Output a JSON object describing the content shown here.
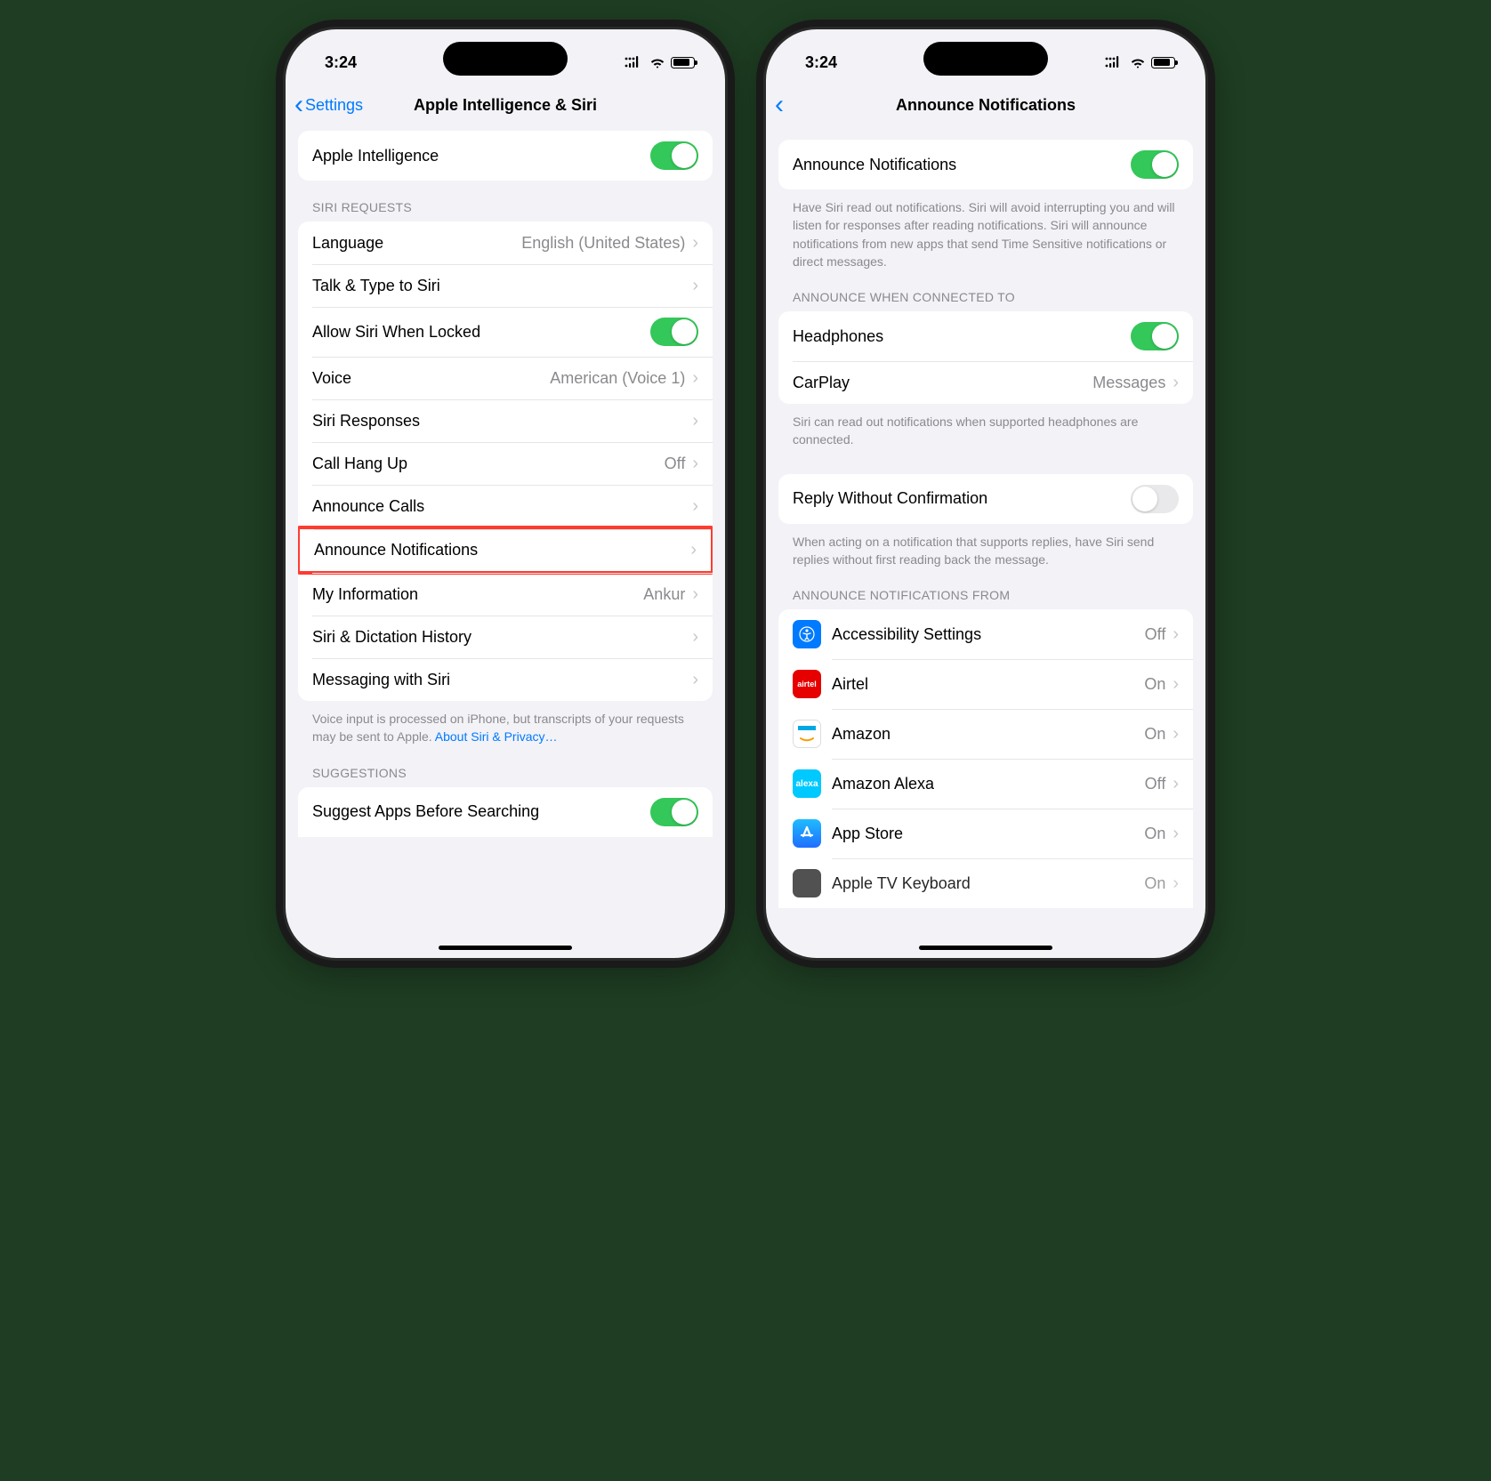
{
  "status": {
    "time": "3:24"
  },
  "left": {
    "back": "Settings",
    "title": "Apple Intelligence & Siri",
    "group1": [
      {
        "label": "Apple Intelligence",
        "type": "toggle",
        "on": true
      }
    ],
    "sec1_header": "SIRI REQUESTS",
    "group2": [
      {
        "label": "Language",
        "value": "English (United States)",
        "type": "nav"
      },
      {
        "label": "Talk & Type to Siri",
        "type": "nav"
      },
      {
        "label": "Allow Siri When Locked",
        "type": "toggle",
        "on": true
      },
      {
        "label": "Voice",
        "value": "American (Voice 1)",
        "type": "nav"
      },
      {
        "label": "Siri Responses",
        "type": "nav"
      },
      {
        "label": "Call Hang Up",
        "value": "Off",
        "type": "nav"
      },
      {
        "label": "Announce Calls",
        "type": "nav"
      },
      {
        "label": "Announce Notifications",
        "type": "nav",
        "highlight": true
      },
      {
        "label": "My Information",
        "value": "Ankur",
        "type": "nav"
      },
      {
        "label": "Siri & Dictation History",
        "type": "nav"
      },
      {
        "label": "Messaging with Siri",
        "type": "nav"
      }
    ],
    "footer1a": "Voice input is processed on iPhone, but transcripts of your requests may be sent to Apple. ",
    "footer1b": "About Siri & Privacy…",
    "sec2_header": "SUGGESTIONS",
    "group3": [
      {
        "label": "Suggest Apps Before Searching",
        "type": "toggle",
        "on": true
      }
    ]
  },
  "right": {
    "title": "Announce Notifications",
    "group1_label": "Announce Notifications",
    "group1_footer": "Have Siri read out notifications. Siri will avoid interrupting you and will listen for responses after reading notifications. Siri will announce notifications from new apps that send Time Sensitive notifications or direct messages.",
    "sec2_header": "ANNOUNCE WHEN CONNECTED TO",
    "group2": [
      {
        "label": "Headphones",
        "type": "toggle",
        "on": true
      },
      {
        "label": "CarPlay",
        "value": "Messages",
        "type": "nav"
      }
    ],
    "footer2": "Siri can read out notifications when supported headphones are connected.",
    "group3_label": "Reply Without Confirmation",
    "footer3": "When acting on a notification that supports replies, have Siri send replies without first reading back the message.",
    "sec4_header": "ANNOUNCE NOTIFICATIONS FROM",
    "apps": [
      {
        "label": "Accessibility Settings",
        "value": "Off",
        "iconBg": "#007aff",
        "iconName": "accessibility-icon"
      },
      {
        "label": "Airtel",
        "value": "On",
        "iconBg": "#e60000",
        "iconName": "airtel-icon"
      },
      {
        "label": "Amazon",
        "value": "On",
        "iconBg": "#fff",
        "iconName": "amazon-icon"
      },
      {
        "label": "Amazon Alexa",
        "value": "Off",
        "iconBg": "#00c9ff",
        "iconName": "alexa-icon"
      },
      {
        "label": "App Store",
        "value": "On",
        "iconBg": "#1e90ff",
        "iconName": "appstore-icon"
      },
      {
        "label": "Apple TV Keyboard",
        "value": "On",
        "iconBg": "#333",
        "iconName": "appletv-icon"
      }
    ]
  }
}
